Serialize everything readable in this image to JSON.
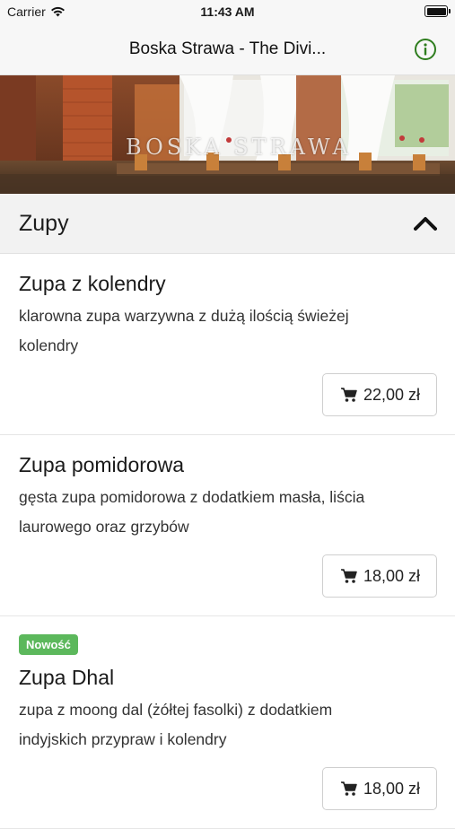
{
  "status_bar": {
    "carrier": "Carrier",
    "time": "11:43 AM"
  },
  "nav": {
    "title": "Boska Strawa - The Divi...",
    "info_icon": "info-circle-icon",
    "accent_color": "#2e7d1e"
  },
  "hero": {
    "banner_text": "BOSKA STRAWA"
  },
  "category": {
    "title": "Zupy",
    "expanded": true
  },
  "items": [
    {
      "name": "Zupa z kolendry",
      "description": "klarowna zupa warzywna z dużą ilością świeżej kolendry",
      "price": "22,00 zł",
      "badge": ""
    },
    {
      "name": "Zupa pomidorowa",
      "description": "gęsta zupa pomidorowa z dodatkiem masła, liścia laurowego oraz grzybów",
      "price": "18,00 zł",
      "badge": ""
    },
    {
      "name": "Zupa Dhal",
      "description": "zupa z moong dal (żółtej fasolki) z dodatkiem indyjskich przypraw i kolendry",
      "price": "18,00 zł",
      "badge": "Nowość"
    }
  ],
  "colors": {
    "badge_green": "#5cb85c",
    "header_bg": "#f2f2f2"
  }
}
